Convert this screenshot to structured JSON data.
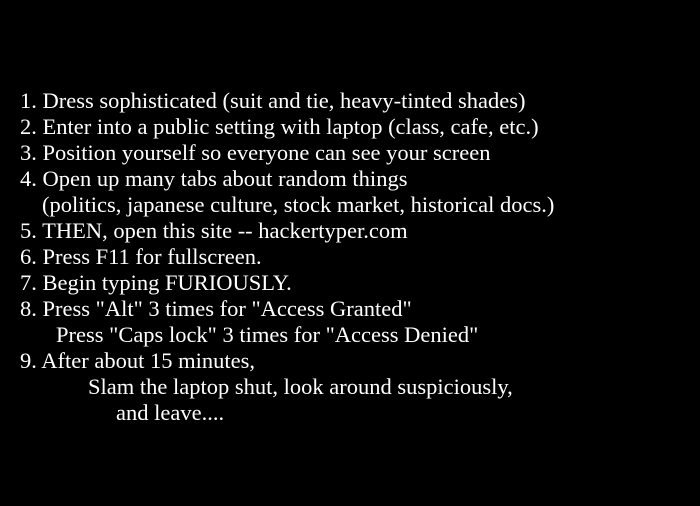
{
  "lines": [
    "1. Dress sophisticated (suit and tie, heavy-tinted shades)",
    "2. Enter into a public setting with laptop (class, cafe, etc.)",
    "3. Position yourself so everyone can see your screen",
    "4. Open up many tabs about random things",
    "(politics, japanese culture, stock market, historical docs.)",
    "5. THEN, open this site -- hackertyper.com",
    "6. Press F11 for fullscreen.",
    "7. Begin typing FURIOUSLY.",
    "8. Press \"Alt\" 3 times for \"Access Granted\"",
    "Press \"Caps lock\" 3 times for \"Access Denied\"",
    "9. After about 15 minutes,",
    "Slam the laptop shut, look around suspiciously,",
    "and leave...."
  ],
  "colors": {
    "background": "#000000",
    "text": "#ffffff"
  }
}
